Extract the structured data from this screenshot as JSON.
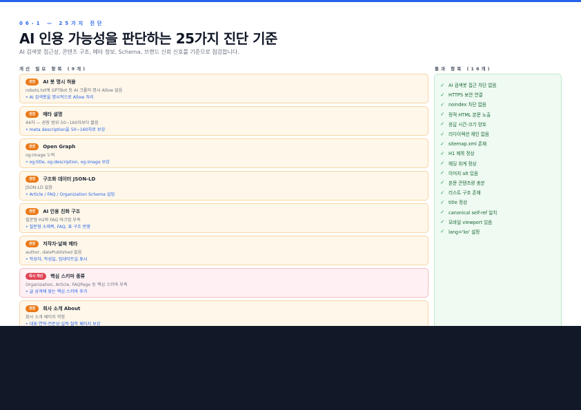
{
  "header": {
    "eyebrow": "06-1 — 25가지 진단",
    "title": "AI 인용 가능성을 판단하는 25가지 진단 기준",
    "subtitle": "AI 검색봇 접근성, 콘텐츠 구조, 메타 정보, Schema, 브랜드 신뢰 신호를 기준으로 점검합니다."
  },
  "failed_section": {
    "heading": "개선 필요 항목 (9개)",
    "items": [
      {
        "badge": "권장",
        "title": "AI 봇 명시 허용",
        "desc": "robots.txt에 GPTBot 등 AI 크롤러 명시 Allow 없음",
        "fix": "• AI 검색봇을 명시적으로 Allow 처리"
      },
      {
        "badge": "권장",
        "title": "메타 설명",
        "desc": "44자 — 권장 범위 50~160자보다 짧음",
        "fix": "• meta description을 50~160자로 보강"
      },
      {
        "badge": "권장",
        "title": "Open Graph",
        "desc": "og:image 누락",
        "fix": "• og:title, og:description, og:image 보강"
      },
      {
        "badge": "권장",
        "title": "구조화 데이터 JSON-LD",
        "desc": "JSON-LD 없음",
        "fix": "• Article / FAQ / Organization Schema 삽입"
      },
      {
        "badge": "권장",
        "title": "AI 인용 친화 구조",
        "desc": "질문형 H2와 FAQ 마크업 부족",
        "fix": "• 질문형 소제목, FAQ, 표 구조 반영"
      },
      {
        "badge": "권장",
        "title": "저작자·날짜 메타",
        "desc": "author, datePublished 없음",
        "fix": "• 작성자, 작성일, 업데이트일 표시"
      },
      {
        "badge": "즉시 개선",
        "title": "핵심 스키마 종류",
        "desc": "Organization, Article, FAQPage 등 핵심 스키마 부족",
        "fix": "• 글 성격에 맞는 핵심 스키마 추가",
        "critical": true
      },
      {
        "badge": "권장",
        "title": "회사 소개 About",
        "desc": "회사 소개 페이지 약함",
        "fix": "• 대표·연혁·전문성·실적·철학 페이지 보강"
      }
    ]
  },
  "passed_section": {
    "heading": "통과 항목 (16개)",
    "check_symbol": "✓",
    "items": [
      "AI 검색봇 접근 차단 없음",
      "HTTPS 보안 연결",
      "noindex 차단 없음",
      "정적 HTML 본문 노출",
      "응답 시간·크기 양호",
      "리다이렉션 체인 없음",
      "sitemap.xml 존재",
      "H1 제목 정상",
      "헤딩 위계 정상",
      "이미지 alt 있음",
      "본문 콘텐츠량 충분",
      "리스트 구조 존재",
      "title 정상",
      "canonical self-ref 일치",
      "모바일 viewport 있음",
      "lang='ko' 설정"
    ]
  },
  "colors": {
    "accent": "#2563eb",
    "recommend_badge": "#ea7a18",
    "critical_badge": "#e04455",
    "pass_green": "#16a34a",
    "footer_dark": "#111827"
  }
}
